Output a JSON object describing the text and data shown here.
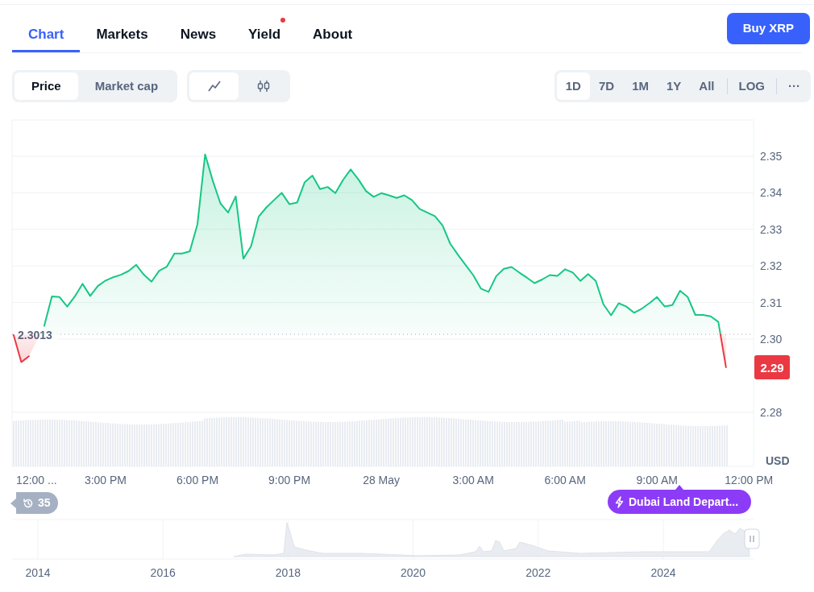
{
  "tabs": [
    {
      "label": "Chart",
      "selected": true,
      "dot": false
    },
    {
      "label": "Markets",
      "selected": false,
      "dot": false
    },
    {
      "label": "News",
      "selected": false,
      "dot": false
    },
    {
      "label": "Yield",
      "selected": false,
      "dot": true
    },
    {
      "label": "About",
      "selected": false,
      "dot": false
    }
  ],
  "buy_button": "Buy XRP",
  "metric_toggle": [
    {
      "label": "Price",
      "selected": true
    },
    {
      "label": "Market cap",
      "selected": false
    }
  ],
  "chart_type_toggle": [
    {
      "kind": "line",
      "selected": true
    },
    {
      "kind": "candles",
      "selected": false
    }
  ],
  "ranges": [
    {
      "label": "1D",
      "selected": true
    },
    {
      "label": "7D",
      "selected": false
    },
    {
      "label": "1M",
      "selected": false
    },
    {
      "label": "1Y",
      "selected": false
    },
    {
      "label": "All",
      "selected": false
    }
  ],
  "log_button": "LOG",
  "more_button": "···",
  "chart": {
    "chart_data": {
      "type": "area",
      "ylabel": "USD",
      "grid": true,
      "categories": [
        null,
        null,
        null,
        "12:00 ...",
        null,
        null,
        null,
        null,
        null,
        null,
        null,
        null,
        "3:00 PM",
        null,
        null,
        null,
        null,
        null,
        null,
        null,
        null,
        null,
        null,
        null,
        "6:00 PM",
        null,
        null,
        null,
        null,
        null,
        null,
        null,
        null,
        null,
        null,
        null,
        "9:00 PM",
        null,
        null,
        null,
        null,
        null,
        null,
        null,
        null,
        null,
        null,
        null,
        "28 May",
        null,
        null,
        null,
        null,
        null,
        null,
        null,
        null,
        null,
        null,
        null,
        "3:00 AM",
        null,
        null,
        null,
        null,
        null,
        null,
        null,
        null,
        null,
        null,
        null,
        "6:00 AM",
        null,
        null,
        null,
        null,
        null,
        null,
        null,
        null,
        null,
        null,
        null,
        "9:00 AM",
        null,
        null,
        null,
        null,
        null,
        null,
        null,
        null,
        null,
        null,
        null,
        "12:00 PM"
      ],
      "series": [
        {
          "color": "#16c784",
          "values": [
            2.3011,
            2.2937,
            2.2953,
            null,
            2.3036,
            2.3117,
            2.3115,
            2.3089,
            2.3117,
            2.3151,
            2.3118,
            2.3145,
            2.316,
            2.3169,
            2.3176,
            2.3186,
            2.3203,
            2.3176,
            2.3157,
            2.3187,
            2.3198,
            2.3234,
            2.3234,
            2.324,
            2.3314,
            2.3505,
            2.3433,
            2.3371,
            2.3346,
            2.339,
            2.322,
            2.3254,
            2.3335,
            2.336,
            2.338,
            2.34,
            2.3369,
            2.3373,
            2.3429,
            2.3447,
            2.341,
            2.3416,
            2.3399,
            2.3435,
            2.3464,
            2.3437,
            2.3405,
            2.3389,
            2.3399,
            2.3393,
            2.3386,
            2.3393,
            2.338,
            2.3356,
            2.3346,
            2.3336,
            2.3311,
            2.3261,
            2.3231,
            2.3203,
            2.3175,
            2.3138,
            2.3129,
            2.3172,
            2.3192,
            2.3197,
            2.3182,
            2.3168,
            2.3153,
            2.3163,
            2.3175,
            2.3173,
            2.3191,
            2.3182,
            2.3159,
            2.3178,
            2.3159,
            2.3095,
            2.3065,
            2.3098,
            2.3089,
            2.3072,
            2.3083,
            2.3098,
            2.3115,
            2.3089,
            2.3093,
            2.3132,
            2.3115,
            2.3066,
            2.3066,
            2.3062,
            2.3047,
            2.2923,
            null,
            null,
            null
          ]
        }
      ],
      "ylim": [
        2.2652,
        2.3599
      ],
      "yticks": [
        {
          "value": 2.28,
          "label": "2.28"
        },
        {
          "value": 2.3,
          "label": "2.30"
        },
        {
          "value": 2.31,
          "label": "2.31"
        },
        {
          "value": 2.32,
          "label": "2.32"
        },
        {
          "value": 2.33,
          "label": "2.33"
        },
        {
          "value": 2.34,
          "label": "2.34"
        },
        {
          "value": 2.35,
          "label": "2.35"
        }
      ],
      "ref_lines": [
        {
          "axis": "y",
          "value": 2.3013,
          "label": "2.3013",
          "color": "#a6b0c3"
        }
      ],
      "annotations": [
        {
          "text": "2.29",
          "y": 2.2923
        }
      ]
    }
  },
  "history_badge": "35",
  "event_badge": "Dubai Land Depart...",
  "navigator": {
    "years": [
      "2014",
      "2016",
      "2018",
      "2020",
      "2022",
      "2024"
    ]
  }
}
